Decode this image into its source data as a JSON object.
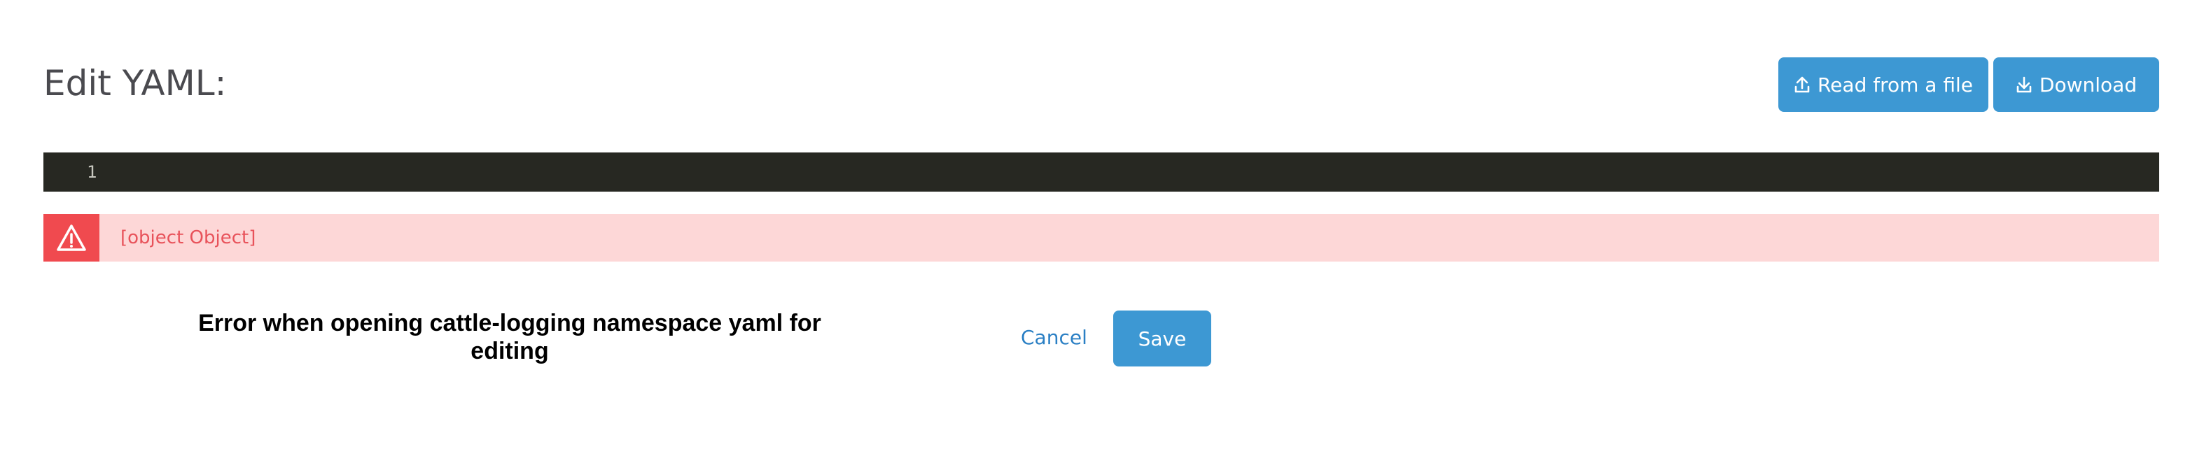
{
  "header": {
    "title": "Edit YAML:",
    "read_button_label": "Read from a file",
    "download_button_label": "Download"
  },
  "editor": {
    "line_numbers": [
      "1"
    ],
    "content": ""
  },
  "error": {
    "message": "[object Object]"
  },
  "caption": {
    "text": "Error when opening cattle-logging namespace yaml for editing"
  },
  "footer": {
    "cancel_label": "Cancel",
    "save_label": "Save"
  },
  "colors": {
    "primary": "#3d98d3",
    "editor_bg": "#272822",
    "error_bg": "#fdd7d7",
    "error_accent": "#f04a4f",
    "link": "#2a7fc4"
  }
}
